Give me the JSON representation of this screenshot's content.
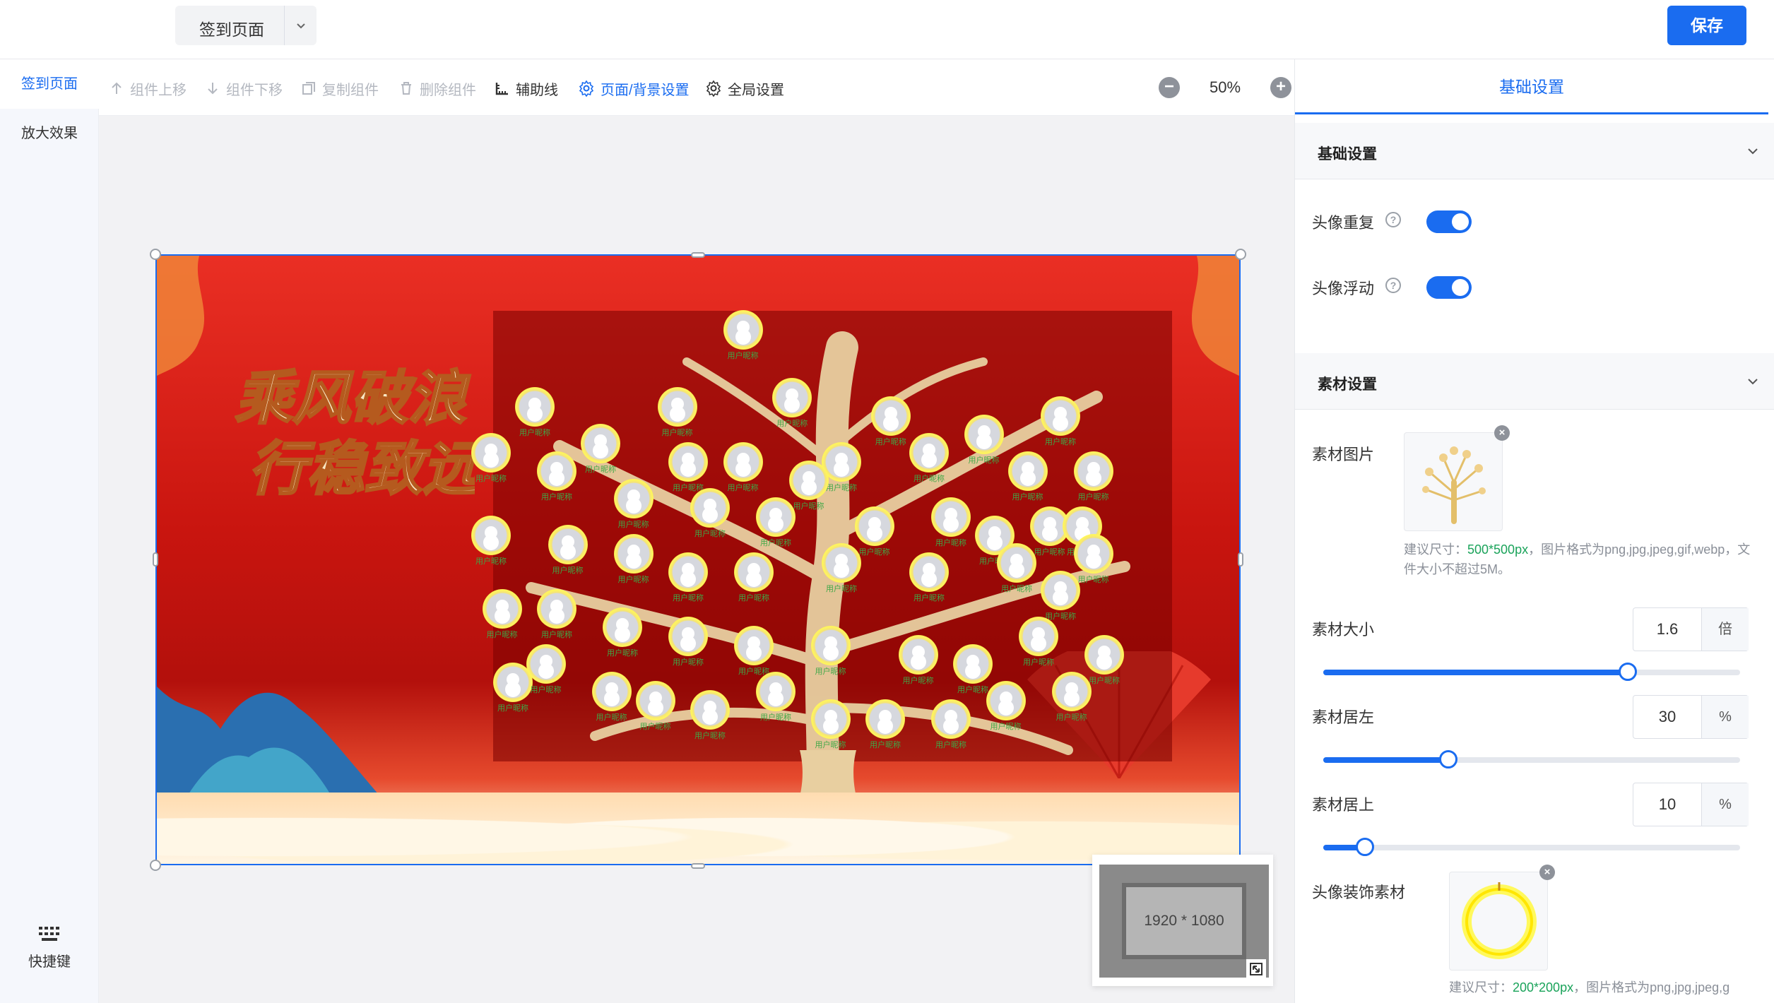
{
  "header": {
    "page_select": "签到页面",
    "save_label": "保存"
  },
  "leftnav": {
    "items": [
      "签到页面",
      "放大效果"
    ],
    "shortcut_label": "快捷键"
  },
  "toolbar": {
    "move_up": "组件上移",
    "move_down": "组件下移",
    "copy": "复制组件",
    "delete": "删除组件",
    "guides": "辅助线",
    "page_bg": "页面/背景设置",
    "global": "全局设置",
    "zoom": "50%"
  },
  "stage": {
    "calligraphy": "乘风破浪 行稳致远",
    "avatar_label": "用户昵称",
    "avatar_count": 56
  },
  "minimap": {
    "size": "1920 * 1080"
  },
  "panel": {
    "tab": "基础设置",
    "section_basic": "基础设置",
    "avatar_repeat": "头像重复",
    "avatar_float": "头像浮动",
    "section_material": "素材设置",
    "material_image": "素材图片",
    "material_hint_prefix": "建议尺寸：",
    "material_hint_size": "500*500px",
    "material_hint_rest": "，图片格式为png,jpg,jpeg,gif,webp，文件大小不超过5M。",
    "material_size": {
      "label": "素材大小",
      "value": "1.6",
      "unit": "倍",
      "fraction": 0.73
    },
    "material_left": {
      "label": "素材居左",
      "value": "30",
      "unit": "%",
      "fraction": 0.3
    },
    "material_top": {
      "label": "素材居上",
      "value": "10",
      "unit": "%",
      "fraction": 0.1
    },
    "deco_label": "头像装饰素材",
    "deco_hint_prefix": "建议尺寸：",
    "deco_hint_size": "200*200px",
    "deco_hint_rest": "，图片格式为png,jpg,jpeg,g"
  },
  "colors": {
    "accent": "#1a6cf0",
    "hint_green": "#1aa35a"
  }
}
